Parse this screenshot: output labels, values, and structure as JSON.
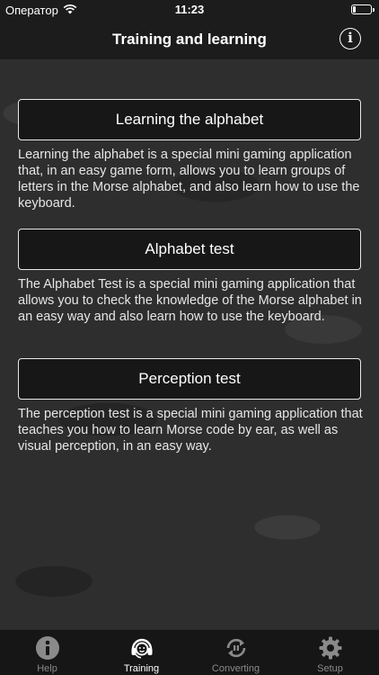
{
  "status_bar": {
    "carrier": "Оператор",
    "time": "11:23"
  },
  "nav": {
    "title": "Training and learning",
    "info_icon": "info-icon"
  },
  "sections": [
    {
      "button_label": "Learning the alphabet",
      "description": "Learning the alphabet is a special mini gaming application that, in an easy game form, allows you to learn groups of letters in the Morse alphabet, and also learn how to use the keyboard."
    },
    {
      "button_label": "Alphabet test",
      "description": "The Alphabet Test is a special mini gaming application that allows you to check the knowledge of the Morse alphabet in an easy way and also learn how to use the keyboard."
    },
    {
      "button_label": "Perception test",
      "description": "The perception test is a special mini gaming application that teaches you how to learn Morse code by ear, as well as visual perception, in an easy way."
    }
  ],
  "tabs": [
    {
      "label": "Help",
      "icon": "info-icon",
      "active": false
    },
    {
      "label": "Training",
      "icon": "headset-icon",
      "active": true
    },
    {
      "label": "Converting",
      "icon": "convert-icon",
      "active": false
    },
    {
      "label": "Setup",
      "icon": "gear-icon",
      "active": false
    }
  ],
  "colors": {
    "background": "#2e2e2e",
    "bar": "#1c1c1c",
    "button_border": "#e8e8e8",
    "tab_inactive": "#8a8a8a",
    "tab_active": "#ffffff"
  }
}
